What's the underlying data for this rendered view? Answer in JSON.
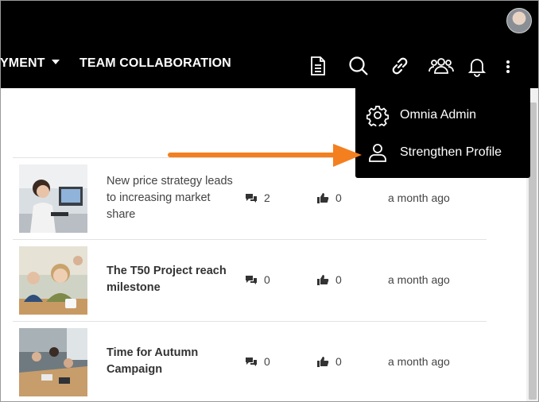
{
  "header": {
    "nav_partial": "YMENT",
    "nav_team": "TEAM COLLABORATION",
    "icons": [
      "document-icon",
      "search-icon",
      "link-icon",
      "people-icon",
      "bell-icon",
      "more-vertical-icon"
    ]
  },
  "dropdown": {
    "items": [
      {
        "label": "Omnia Admin",
        "icon": "gear-icon"
      },
      {
        "label": "Strengthen Profile",
        "icon": "user-icon"
      }
    ]
  },
  "news": [
    {
      "title": "New price strategy leads to increasing market share",
      "comments": "2",
      "likes": "0",
      "time": "a month ago",
      "read": true
    },
    {
      "title": "The T50 Project reach milestone",
      "comments": "0",
      "likes": "0",
      "time": "a month ago",
      "read": false
    },
    {
      "title": "Time for Autumn Campaign",
      "comments": "0",
      "likes": "0",
      "time": "a month ago",
      "read": false
    }
  ],
  "colors": {
    "header_bg": "#000000",
    "accent_arrow": "#f47f1f"
  }
}
